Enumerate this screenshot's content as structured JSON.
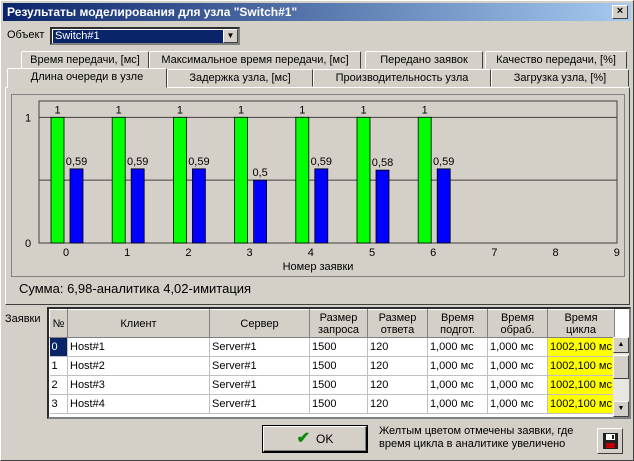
{
  "window": {
    "title": "Результаты моделирования для узла \"Switch#1\"",
    "close_glyph": "×"
  },
  "object": {
    "label": "Объект",
    "value": "Switch#1"
  },
  "tabs_top": [
    "Время передачи, [мс]",
    "Максимальное время передачи, [мс]",
    "Передано заявок",
    "Качество передачи, [%]"
  ],
  "tabs_bottom": [
    "Длина очереди в узле",
    "Задержка узла, [мс]",
    "Производительность узла",
    "Загрузка узла, [%]"
  ],
  "active_tab": "Длина очереди в узле",
  "chart_data": {
    "type": "bar",
    "xlabel": "Номер заявки",
    "ylabel": "",
    "x_ticks": [
      "0",
      "1",
      "2",
      "3",
      "4",
      "5",
      "6",
      "7",
      "8",
      "9"
    ],
    "y_ticks": [
      "0",
      "1"
    ],
    "ylim": [
      0,
      1.13
    ],
    "grid": true,
    "series": [
      {
        "color": "#00ff00",
        "values": [
          1,
          1,
          1,
          1,
          1,
          1,
          1
        ],
        "labels": [
          "1",
          "1",
          "1",
          "1",
          "1",
          "1",
          "1"
        ]
      },
      {
        "color": "#0000ff",
        "values": [
          0.59,
          0.59,
          0.59,
          0.5,
          0.59,
          0.58,
          0.59
        ],
        "labels": [
          "0,59",
          "0,59",
          "0,59",
          "0,5",
          "0,59",
          "0,58",
          "0,59"
        ]
      }
    ]
  },
  "summary": "Сумма: 6,98-аналитика   4,02-имитация",
  "requests_label": "Заявки",
  "table": {
    "headers": [
      "№",
      "Клиент",
      "Сервер",
      "Размер запроса",
      "Размер ответа",
      "Время подгот.",
      "Время обраб.",
      "Время цикла"
    ],
    "rows": [
      [
        "0",
        "Host#1",
        "Server#1",
        "1500",
        "120",
        "1,000 мс",
        "1,000 мс",
        "1002,100 мс"
      ],
      [
        "1",
        "Host#2",
        "Server#1",
        "1500",
        "120",
        "1,000 мс",
        "1,000 мс",
        "1002,100 мс"
      ],
      [
        "2",
        "Host#3",
        "Server#1",
        "1500",
        "120",
        "1,000 мс",
        "1,000 мс",
        "1002,100 мс"
      ],
      [
        "3",
        "Host#4",
        "Server#1",
        "1500",
        "120",
        "1,000 мс",
        "1,000 мс",
        "1002,100 мс"
      ]
    ]
  },
  "ok_label": "OK",
  "note": "Желтым цветом отмечены заявки, где время цикла в аналитике увеличено",
  "colors": {
    "highlight": "#ffff00",
    "selection": "#0a246a"
  }
}
